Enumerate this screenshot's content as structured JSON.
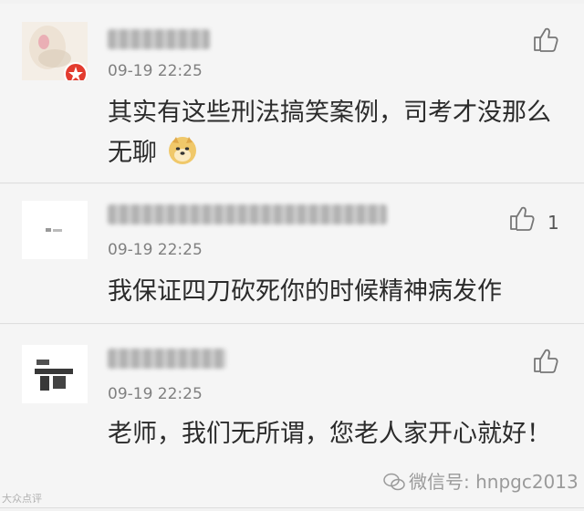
{
  "comments": [
    {
      "username": "",
      "time": "09-19 22:25",
      "text": "其实有这些刑法搞笑案例，司考才没那么无聊",
      "emoji": "doge-emoji",
      "like_count": "",
      "avatar_badge": "red-star-badge"
    },
    {
      "username": "",
      "time": "09-19 22:25",
      "text": "我保证四刀砍死你的时候精神病发作",
      "like_count": "1"
    },
    {
      "username": "",
      "time": "09-19 22:25",
      "text": "老师，我们无所谓，您老人家开心就好！",
      "like_count": ""
    }
  ],
  "watermark": "微信号: hnpgc2013",
  "corner_mark": "大众点评",
  "colors": {
    "background": "#f5f5f5",
    "text": "#2b2b2b",
    "time": "#808080",
    "badge": "#e33b2e"
  }
}
